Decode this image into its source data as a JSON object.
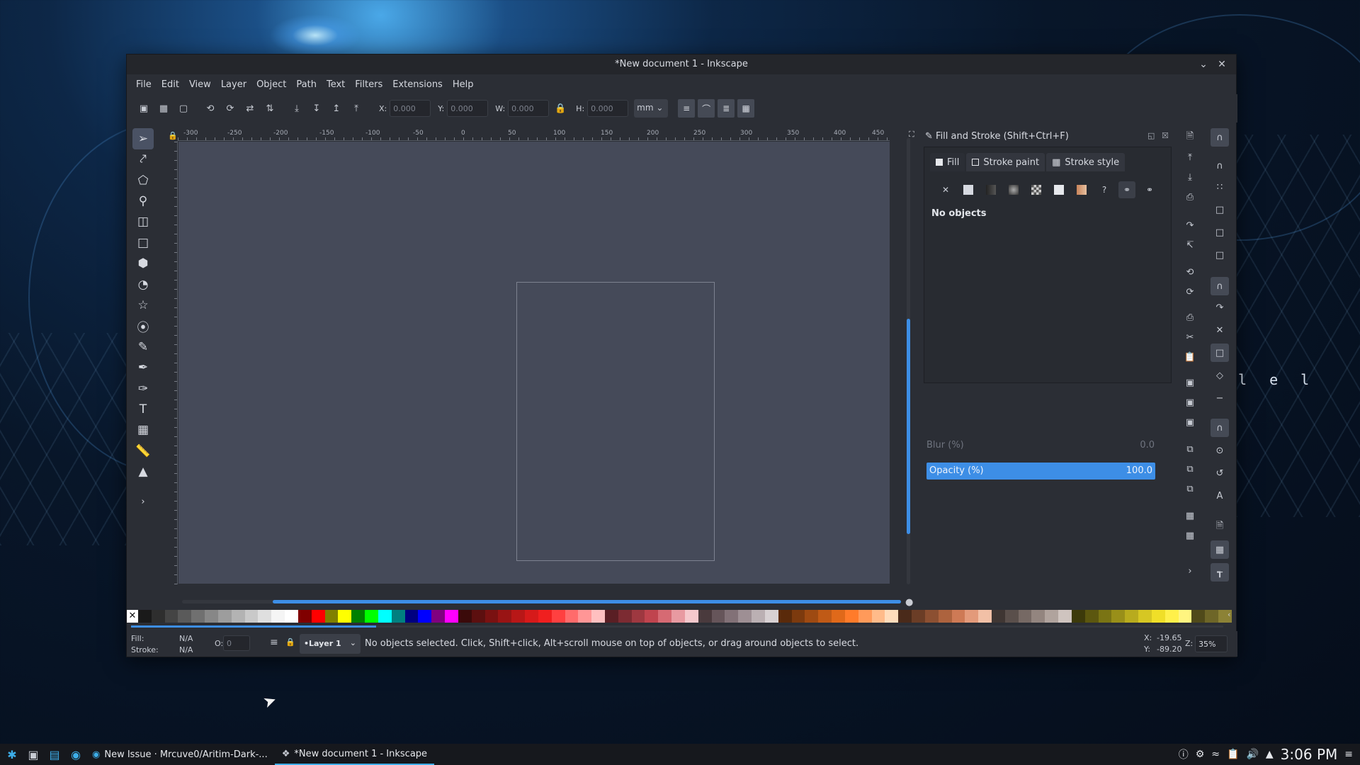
{
  "window": {
    "title": "*New document 1 - Inkscape"
  },
  "menu": [
    "File",
    "Edit",
    "View",
    "Layer",
    "Object",
    "Path",
    "Text",
    "Filters",
    "Extensions",
    "Help"
  ],
  "toolbar": {
    "x_label": "X:",
    "x_value": "0.000",
    "y_label": "Y:",
    "y_value": "0.000",
    "w_label": "W:",
    "w_value": "0.000",
    "h_label": "H:",
    "h_value": "0.000",
    "unit": "mm"
  },
  "ruler": {
    "top_labels": [
      "-300",
      "-250",
      "-200",
      "-150",
      "-100",
      "-50",
      "0",
      "50",
      "100",
      "150",
      "200",
      "250",
      "300",
      "350",
      "400",
      "450"
    ]
  },
  "dock": {
    "title": "Fill and Stroke (Shift+Ctrl+F)",
    "tabs": [
      "Fill",
      "Stroke paint",
      "Stroke style"
    ],
    "message": "No objects",
    "blur_label": "Blur (%)",
    "blur_value": "0.0",
    "opacity_label": "Opacity (%)",
    "opacity_value": "100.0"
  },
  "palette": [
    "#1a1a1a",
    "#2e2e2e",
    "#444",
    "#5a5a5a",
    "#707070",
    "#878787",
    "#9d9d9d",
    "#b3b3b3",
    "#c9c9c9",
    "#dfdfdf",
    "#f5f5f5",
    "#ffffff",
    "#800000",
    "#ff0000",
    "#808000",
    "#ffff00",
    "#008000",
    "#00ff00",
    "#00ffff",
    "#008080",
    "#000080",
    "#0000ff",
    "#800080",
    "#ff00ff",
    "#3b0a0a",
    "#5c0f0f",
    "#7a1111",
    "#991414",
    "#b81717",
    "#d61a1a",
    "#f01f1f",
    "#ff4040",
    "#ff6b6b",
    "#ff9696",
    "#ffc0c0",
    "#5a1f24",
    "#7c2b32",
    "#9e3840",
    "#c0444e",
    "#d66a73",
    "#e89aa1",
    "#f5c8cc",
    "#4a3a3d",
    "#66555a",
    "#827177",
    "#9e8f94",
    "#bbb0b3",
    "#d8d1d3",
    "#5a2a0a",
    "#7c3a0e",
    "#9e4a12",
    "#c05a16",
    "#e0691a",
    "#ff7b2a",
    "#ff9a5a",
    "#ffbb8a",
    "#ffdcbb",
    "#4a2a1a",
    "#6b3d26",
    "#8c5032",
    "#ad633e",
    "#ce7a55",
    "#e39a7a",
    "#f2c0a6",
    "#3f3633",
    "#5a4f4b",
    "#766964",
    "#93857f",
    "#b0a39d",
    "#cfc4bf",
    "#3d3a0a",
    "#5c570f",
    "#7a7414",
    "#998f19",
    "#b8ab1e",
    "#d6c723",
    "#f0df28",
    "#fff04a",
    "#fff580",
    "#504a1a",
    "#6e6628",
    "#8c8236"
  ],
  "status": {
    "fill_label": "Fill:",
    "fill_value": "N/A",
    "stroke_label": "Stroke:",
    "stroke_value": "N/A",
    "o_label": "O:",
    "o_value": "0",
    "layer": "•Layer 1",
    "message": "No objects selected. Click, Shift+click, Alt+scroll mouse on top of objects, or drag around objects to select.",
    "x_label": "X:",
    "x_value": "-19.65",
    "y_label": "Y:",
    "y_value": "-89.20",
    "z_label": "Z:",
    "zoom": "35%"
  },
  "desktop": {
    "overlay_text": "l e l"
  },
  "taskbar": {
    "tasks": [
      "New Issue · Mrcuve0/Aritim-Dark-...",
      "*New document 1 - Inkscape"
    ],
    "clock": "3:06 PM"
  }
}
